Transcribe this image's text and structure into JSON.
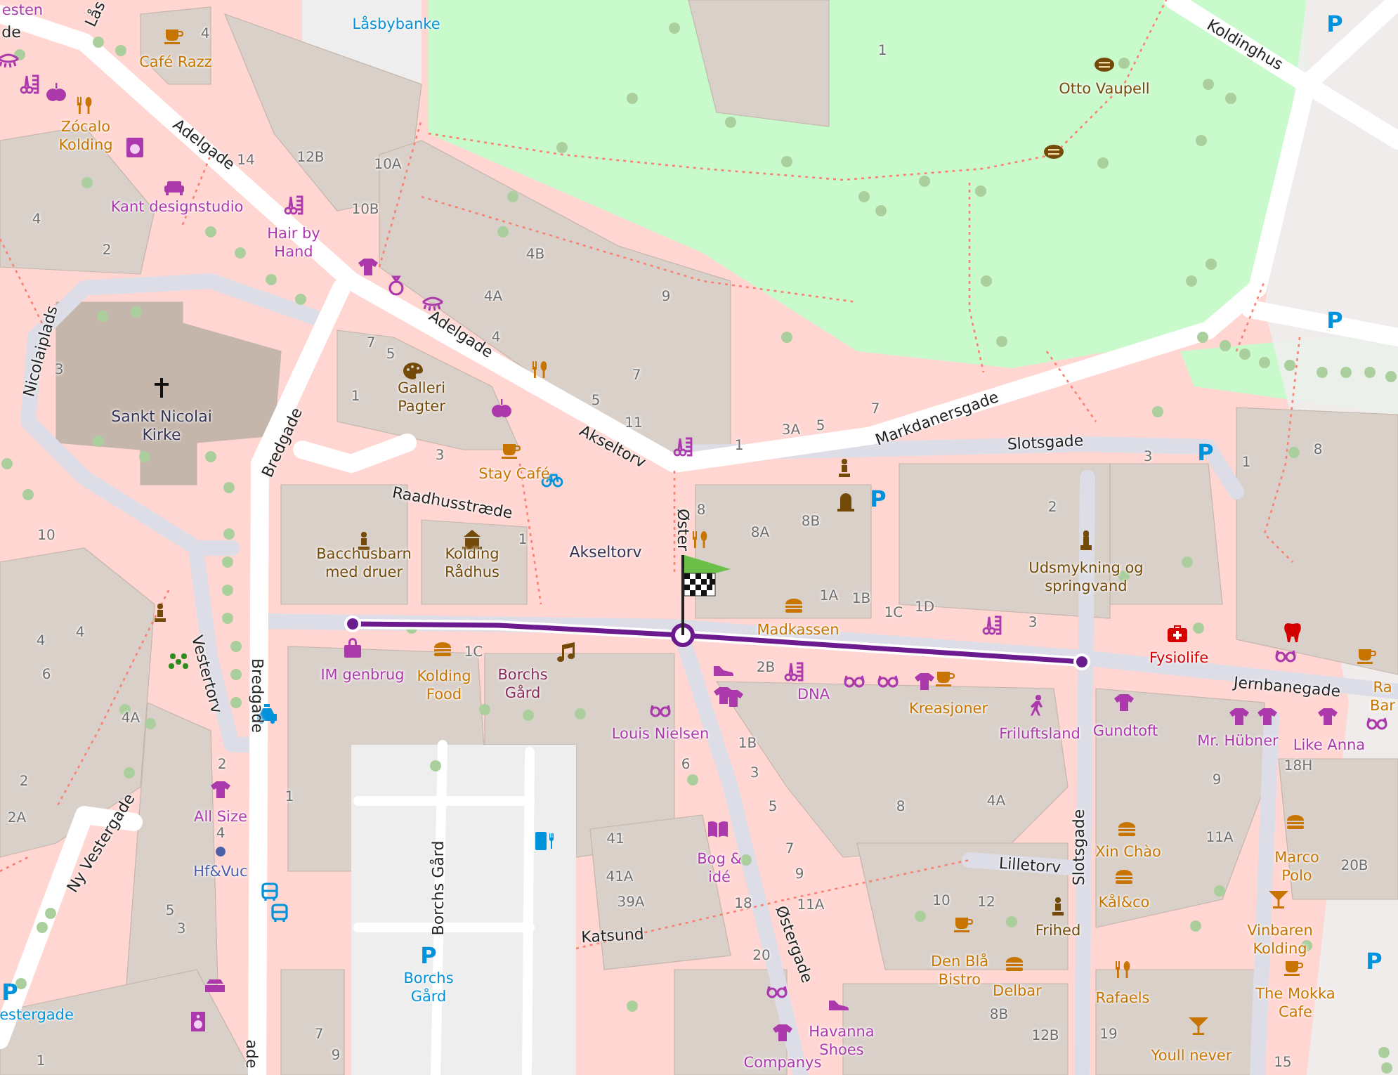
{
  "map": {
    "street_labels": [
      {
        "text": "de"
      },
      {
        "text": "Lås"
      },
      {
        "text": "Adelgade"
      },
      {
        "text": "Adelgade"
      },
      {
        "text": "Akseltorv"
      },
      {
        "text": "Markdanersgade"
      },
      {
        "text": "Koldinghus"
      },
      {
        "text": "Slotsgade"
      },
      {
        "text": "Nicolaiplads"
      },
      {
        "text": "Bredgade"
      },
      {
        "text": "Raadhusstræde"
      },
      {
        "text": "Øster"
      },
      {
        "text": "Vestertorv"
      },
      {
        "text": "Bredgade"
      },
      {
        "text": "Ny Vestergade"
      },
      {
        "text": "Borchs Gård"
      },
      {
        "text": "ade"
      },
      {
        "text": "Katsund"
      },
      {
        "text": "Jernbanegade"
      },
      {
        "text": "Lilletorv"
      },
      {
        "text": "Slotsgade"
      },
      {
        "text": "Østergade"
      }
    ],
    "poi_labels": [
      {
        "name": "esten",
        "kind": "shop"
      },
      {
        "name": "Låsbybanke",
        "kind": "parking"
      },
      {
        "name": "Café Razz",
        "kind": "food"
      },
      {
        "name": "Zócalo Kolding",
        "kind": "food"
      },
      {
        "name": "Kant designstudio",
        "kind": "shop"
      },
      {
        "name": "Hair by Hand",
        "kind": "shop"
      },
      {
        "name": "Otto Vaupell",
        "kind": "culture"
      },
      {
        "name": "Sankt Nicolai Kirke",
        "kind": "place"
      },
      {
        "name": "Galleri Pagter",
        "kind": "culture"
      },
      {
        "name": "Stay Café",
        "kind": "food"
      },
      {
        "name": "Bacchusbarn med druer",
        "kind": "culture"
      },
      {
        "name": "Kolding Rådhus",
        "kind": "culture"
      },
      {
        "name": "Akseltorv",
        "kind": "place"
      },
      {
        "name": "Madkassen",
        "kind": "food"
      },
      {
        "name": "IM genbrug",
        "kind": "shop"
      },
      {
        "name": "Kolding Food",
        "kind": "food"
      },
      {
        "name": "Borchs Gård",
        "kind": "venue"
      },
      {
        "name": "Louis Nielsen",
        "kind": "shop"
      },
      {
        "name": "DNA",
        "kind": "shop"
      },
      {
        "name": "Kreasjoner",
        "kind": "food"
      },
      {
        "name": "Friluftsland",
        "kind": "shop"
      },
      {
        "name": "Gundtoft",
        "kind": "shop"
      },
      {
        "name": "Fysiolife",
        "kind": "health"
      },
      {
        "name": "Mr. Hübner",
        "kind": "shop"
      },
      {
        "name": "Like Anna",
        "kind": "shop"
      },
      {
        "name": "Ra Bar",
        "kind": "food"
      },
      {
        "name": "Udsmykning og springvand",
        "kind": "culture"
      },
      {
        "name": "Bog & idé",
        "kind": "shop"
      },
      {
        "name": "Xin Chào",
        "kind": "food"
      },
      {
        "name": "Kål&co",
        "kind": "food"
      },
      {
        "name": "Frihed",
        "kind": "culture"
      },
      {
        "name": "Marco Polo",
        "kind": "food"
      },
      {
        "name": "Vinbaren Kolding",
        "kind": "food"
      },
      {
        "name": "Den Blå Bistro",
        "kind": "food"
      },
      {
        "name": "Delbar",
        "kind": "food"
      },
      {
        "name": "Rafaels",
        "kind": "food"
      },
      {
        "name": "The Mokka Cafe",
        "kind": "food"
      },
      {
        "name": "Havanna Shoes",
        "kind": "shop"
      },
      {
        "name": "Companys",
        "kind": "shop"
      },
      {
        "name": "Youll never",
        "kind": "food"
      },
      {
        "name": "All Size",
        "kind": "shop"
      },
      {
        "name": "Hf&Vuc",
        "kind": "office"
      },
      {
        "name": "Borchs Gård",
        "kind": "parking"
      },
      {
        "name": "estergade",
        "kind": "parking"
      }
    ],
    "parking_signs": [
      "P",
      "P",
      "P",
      "P",
      "P",
      "P",
      "P"
    ],
    "house_numbers": [
      "4",
      "1",
      "14",
      "12B",
      "10A",
      "10B",
      "4",
      "2",
      "4B",
      "4A",
      "9",
      "7",
      "5",
      "4",
      "7",
      "3",
      "1",
      "5",
      "11",
      "3A",
      "5",
      "7",
      "1",
      "3",
      "3",
      "1",
      "8",
      "8",
      "8A",
      "8B",
      "2",
      "10",
      "1",
      "1A",
      "1B",
      "1C",
      "1D",
      "3",
      "4",
      "4",
      "6",
      "4A",
      "2",
      "2A",
      "2",
      "4",
      "1",
      "5",
      "3",
      "1C",
      "2B",
      "1B",
      "6",
      "3",
      "5",
      "7",
      "9",
      "18",
      "11A",
      "20",
      "41",
      "41A",
      "39A",
      "8",
      "4A",
      "10",
      "12",
      "8B",
      "12B",
      "19",
      "9",
      "11A",
      "18H",
      "20B",
      "15",
      "1",
      "7",
      "9"
    ]
  }
}
